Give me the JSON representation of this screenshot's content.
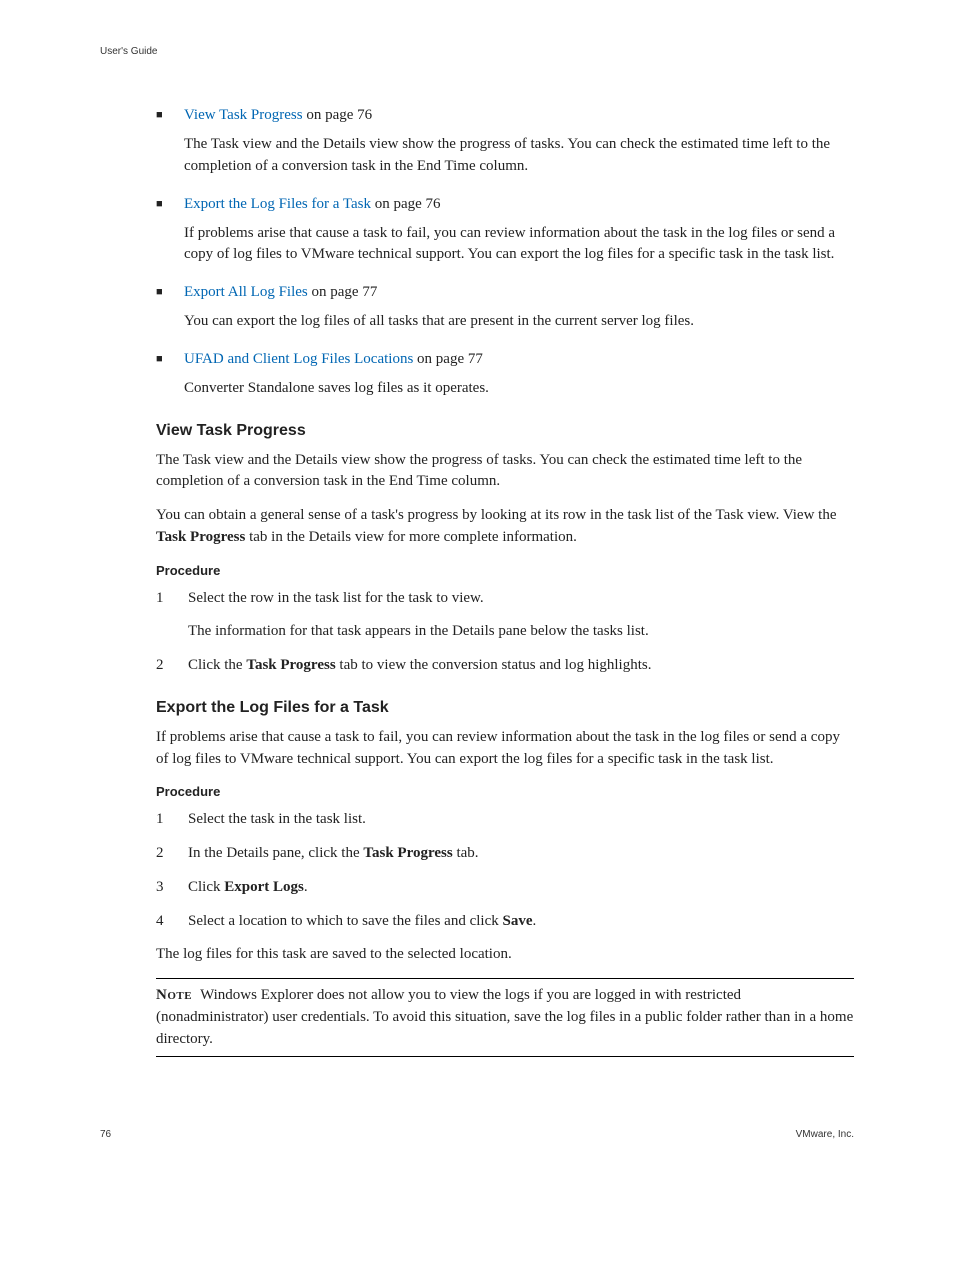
{
  "header": {
    "title": "User's Guide"
  },
  "bullets": [
    {
      "link": "View Task Progress",
      "suffix": " on page 76",
      "desc": "The Task view and the Details view show the progress of tasks. You can check the estimated time left to the completion of a conversion task in the End Time column."
    },
    {
      "link": "Export the Log Files for a Task",
      "suffix": " on page 76",
      "desc": "If problems arise that cause a task to fail, you can review information about the task in the log files or send a copy of log files to VMware technical support. You can export the log files for a specific task in the task list."
    },
    {
      "link": "Export All Log Files",
      "suffix": " on page 77",
      "desc": "You can export the log files of all tasks that are present in the current server log files."
    },
    {
      "link": "UFAD and Client Log Files Locations",
      "suffix": " on page 77",
      "desc": "Converter Standalone saves log files as it operates."
    }
  ],
  "section1": {
    "heading": "View Task Progress",
    "p1": "The Task view and the Details view show the progress of tasks. You can check the estimated time left to the completion of a conversion task in the End Time column.",
    "p2_a": "You can obtain a general sense of a task's progress by looking at its row in the task list of the Task view. View the ",
    "p2_b": "Task Progress",
    "p2_c": " tab in the Details view for more complete information.",
    "procedure": "Procedure",
    "steps": [
      {
        "n": "1",
        "t": "Select the row in the task list for the task to view.",
        "sub": "The information for that task appears in the Details pane below the tasks list."
      },
      {
        "n": "2",
        "t_a": "Click the ",
        "t_b": "Task Progress",
        "t_c": " tab to view the conversion status and log highlights."
      }
    ]
  },
  "section2": {
    "heading": "Export the Log Files for a Task",
    "p1": "If problems arise that cause a task to fail, you can review information about the task in the log files or send a copy of log files to VMware technical support. You can export the log files for a specific task in the task list.",
    "procedure": "Procedure",
    "steps": [
      {
        "n": "1",
        "t": "Select the task in the task list."
      },
      {
        "n": "2",
        "t_a": "In the Details pane, click the ",
        "t_b": "Task Progress",
        "t_c": " tab."
      },
      {
        "n": "3",
        "t_a": "Click ",
        "t_b": "Export Logs",
        "t_c": "."
      },
      {
        "n": "4",
        "t_a": "Select a location to which to save the files and click ",
        "t_b": "Save",
        "t_c": "."
      }
    ],
    "after": "The log files for this task are saved to the selected location.",
    "note_label": "Note",
    "note": "Windows Explorer does not allow you to view the logs if you are logged in with restricted (nonadministrator) user credentials. To avoid this situation, save the log files in a public folder rather than in a home directory."
  },
  "footer": {
    "page": "76",
    "brand": "VMware, Inc."
  }
}
